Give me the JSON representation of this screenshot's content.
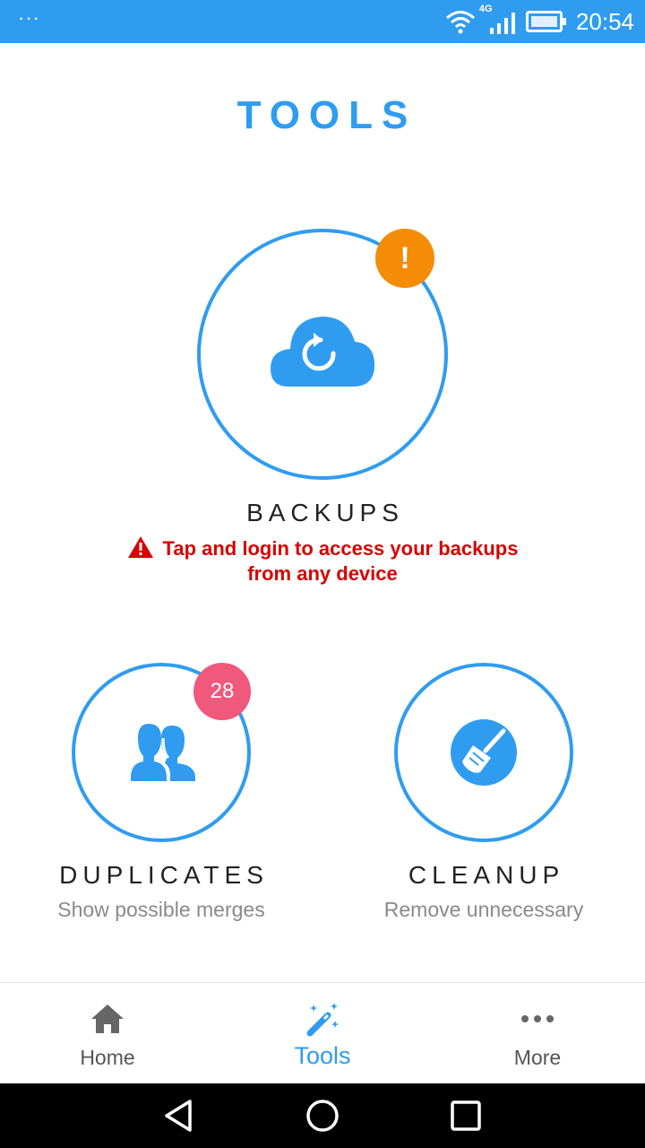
{
  "status_bar": {
    "menu_dots": "···",
    "network": "4G",
    "time": "20:54"
  },
  "page": {
    "title": "TOOLS"
  },
  "backups": {
    "label": "BACKUPS",
    "warning_line1": "Tap and login to access your backups",
    "warning_line2": "from any device",
    "badge": "!",
    "icon": "cloud-restore-icon"
  },
  "duplicates": {
    "label": "DUPLICATES",
    "subtitle": "Show possible merges",
    "badge_count": "28",
    "icon": "people-icon"
  },
  "cleanup": {
    "label": "CLEANUP",
    "subtitle": "Remove unnecessary",
    "icon": "broom-icon"
  },
  "bottom_nav": {
    "items": [
      {
        "label": "Home",
        "icon": "home-icon"
      },
      {
        "label": "Tools",
        "icon": "magic-wand-icon",
        "active": true
      },
      {
        "label": "More",
        "icon": "more-dots-icon"
      }
    ]
  },
  "colors": {
    "accent": "#2f9cf0",
    "warning_badge": "#f48c06",
    "count_badge": "#f0587c",
    "error_text": "#d80000"
  }
}
